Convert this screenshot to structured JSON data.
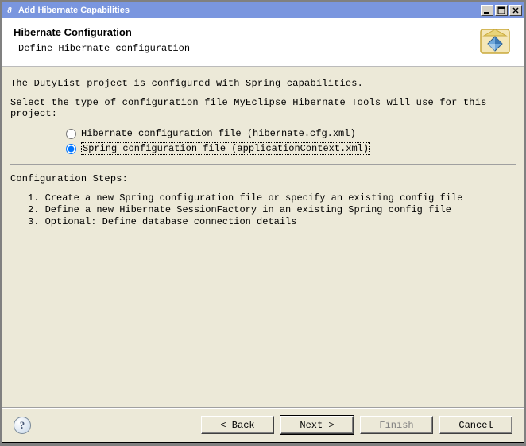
{
  "window": {
    "title": "Add Hibernate Capabilities"
  },
  "header": {
    "title": "Hibernate Configuration",
    "subtitle": "Define Hibernate configuration"
  },
  "content": {
    "project_line": "The DutyList project is configured with Spring capabilities.",
    "select_line": "Select the type of configuration file MyEclipse Hibernate Tools will use for this project:",
    "radios": {
      "hibernate": "Hibernate configuration file (hibernate.cfg.xml)",
      "spring": "Spring configuration file (applicationContext.xml)"
    },
    "steps_title": "Configuration Steps:",
    "steps": [
      "Create a new Spring configuration file or specify an existing config file",
      "Define a new Hibernate SessionFactory in an existing Spring config file",
      "Optional: Define database connection details"
    ]
  },
  "buttons": {
    "back_prefix": "< ",
    "back_letter": "B",
    "back_rest": "ack",
    "next_letter": "N",
    "next_rest": "ext >",
    "finish_letter": "F",
    "finish_rest": "inish",
    "cancel": "Cancel"
  }
}
